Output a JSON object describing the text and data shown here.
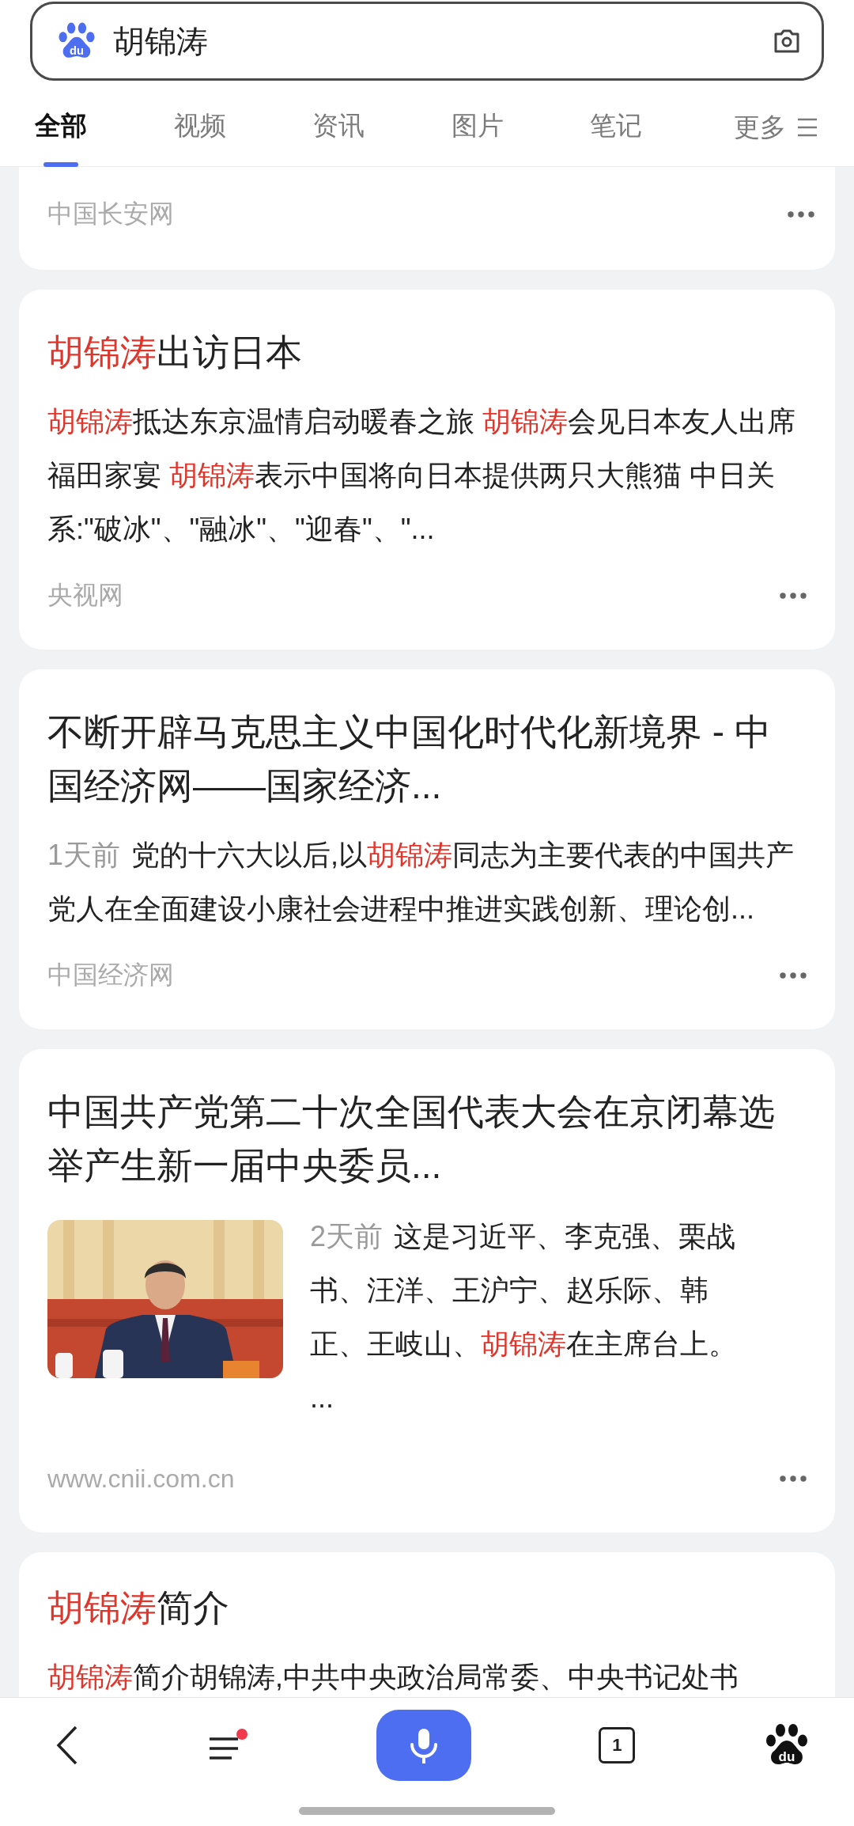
{
  "search": {
    "logo_text": "du",
    "query": "胡锦涛"
  },
  "tabs": [
    {
      "label": "全部",
      "selected": true
    },
    {
      "label": "视频",
      "selected": false
    },
    {
      "label": "资讯",
      "selected": false
    },
    {
      "label": "图片",
      "selected": false
    },
    {
      "label": "笔记",
      "selected": false
    }
  ],
  "more_tab": {
    "label": "更多"
  },
  "results": [
    {
      "kind": "tail",
      "source": "中国长安网"
    },
    {
      "kind": "text",
      "title": [
        {
          "text": "胡锦涛",
          "highlight": true
        },
        {
          "text": "出访日本",
          "highlight": false
        }
      ],
      "snippet": [
        {
          "text": "胡锦涛",
          "highlight": true
        },
        {
          "text": "抵达东京温情启动暖春之旅 ",
          "highlight": false
        },
        {
          "text": "胡锦涛",
          "highlight": true
        },
        {
          "text": "会见日本友人出席福田家宴 ",
          "highlight": false
        },
        {
          "text": "胡锦涛",
          "highlight": true
        },
        {
          "text": "表示中国将向日本提供两只大熊猫 中日关系:\"破冰\"、\"融冰\"、\"迎春\"、\"...",
          "highlight": false
        }
      ],
      "source": "央视网"
    },
    {
      "kind": "text",
      "title": [
        {
          "text": "不断开辟马克思主义中国化时代化新境界 - 中国经济网——国家经济...",
          "highlight": false
        }
      ],
      "time": "1天前",
      "snippet": [
        {
          "text": "党的十六大以后,以",
          "highlight": false
        },
        {
          "text": "胡锦涛",
          "highlight": true
        },
        {
          "text": "同志为主要代表的中国共产党人在全面建设小康社会进程中推进实践创新、理论创...",
          "highlight": false
        }
      ],
      "source": "中国经济网"
    },
    {
      "title": [
        {
          "text": "中国共产党第二十次全国代表大会在京闭幕选举产生新一届中央委员...",
          "highlight": false
        }
      ],
      "time": "2天前",
      "snippet": [
        {
          "text": "这是习近平、李克强、栗战书、汪洋、王沪宁、赵乐际、韩正、王岐山、",
          "highlight": false
        },
        {
          "text": "胡锦涛",
          "highlight": true
        },
        {
          "text": "在主席台上。 ...",
          "highlight": false
        }
      ],
      "source": "www.cnii.com.cn"
    },
    {
      "kind": "cut",
      "title": [
        {
          "text": "胡锦涛",
          "highlight": true
        },
        {
          "text": "简介",
          "highlight": false
        }
      ],
      "snippet": [
        {
          "text": "胡锦涛",
          "highlight": true
        },
        {
          "text": "简介胡锦涛,中共中央政治局常委、中央书记处书",
          "highlight": false
        }
      ]
    }
  ],
  "bottom_bar": {
    "menu_badge": true,
    "tab_count": "1",
    "logo_text": "du"
  }
}
